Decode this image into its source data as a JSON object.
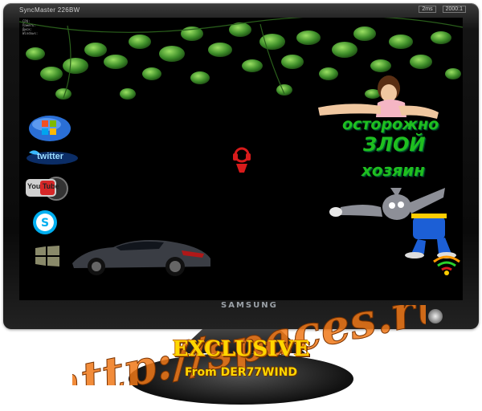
{
  "monitor": {
    "model": "SyncMaster 226BW",
    "badges": [
      "2ms",
      "2000:1"
    ],
    "brand": "SAMSUNG"
  },
  "screen": {
    "sysinfo": [
      "CPU:",
      "Память:",
      "Диск:",
      "Windows:"
    ],
    "icons": {
      "windows_orb": "windows-orb-icon",
      "twitter": "twitter",
      "youtube": "You Tube",
      "skype": "skype-icon",
      "windows_flag": "windows-flag-icon",
      "wifi_bottom_right": "wifi-icon"
    },
    "sign_text": [
      "осторожно",
      "ЗЛОЙ",
      "хозяин"
    ]
  },
  "overlay": {
    "url_text": "http://spaces.ru",
    "exclusive": "EXCLUSIVE",
    "from": "From DER77WIND"
  },
  "colors": {
    "bezel": "#111111",
    "screen_bg": "#000000",
    "leaves": "#3f8f2a",
    "overlay_orange": "#f07818",
    "exclusive_gold": "#ffd700",
    "sign_green": "#1fbf1f"
  }
}
